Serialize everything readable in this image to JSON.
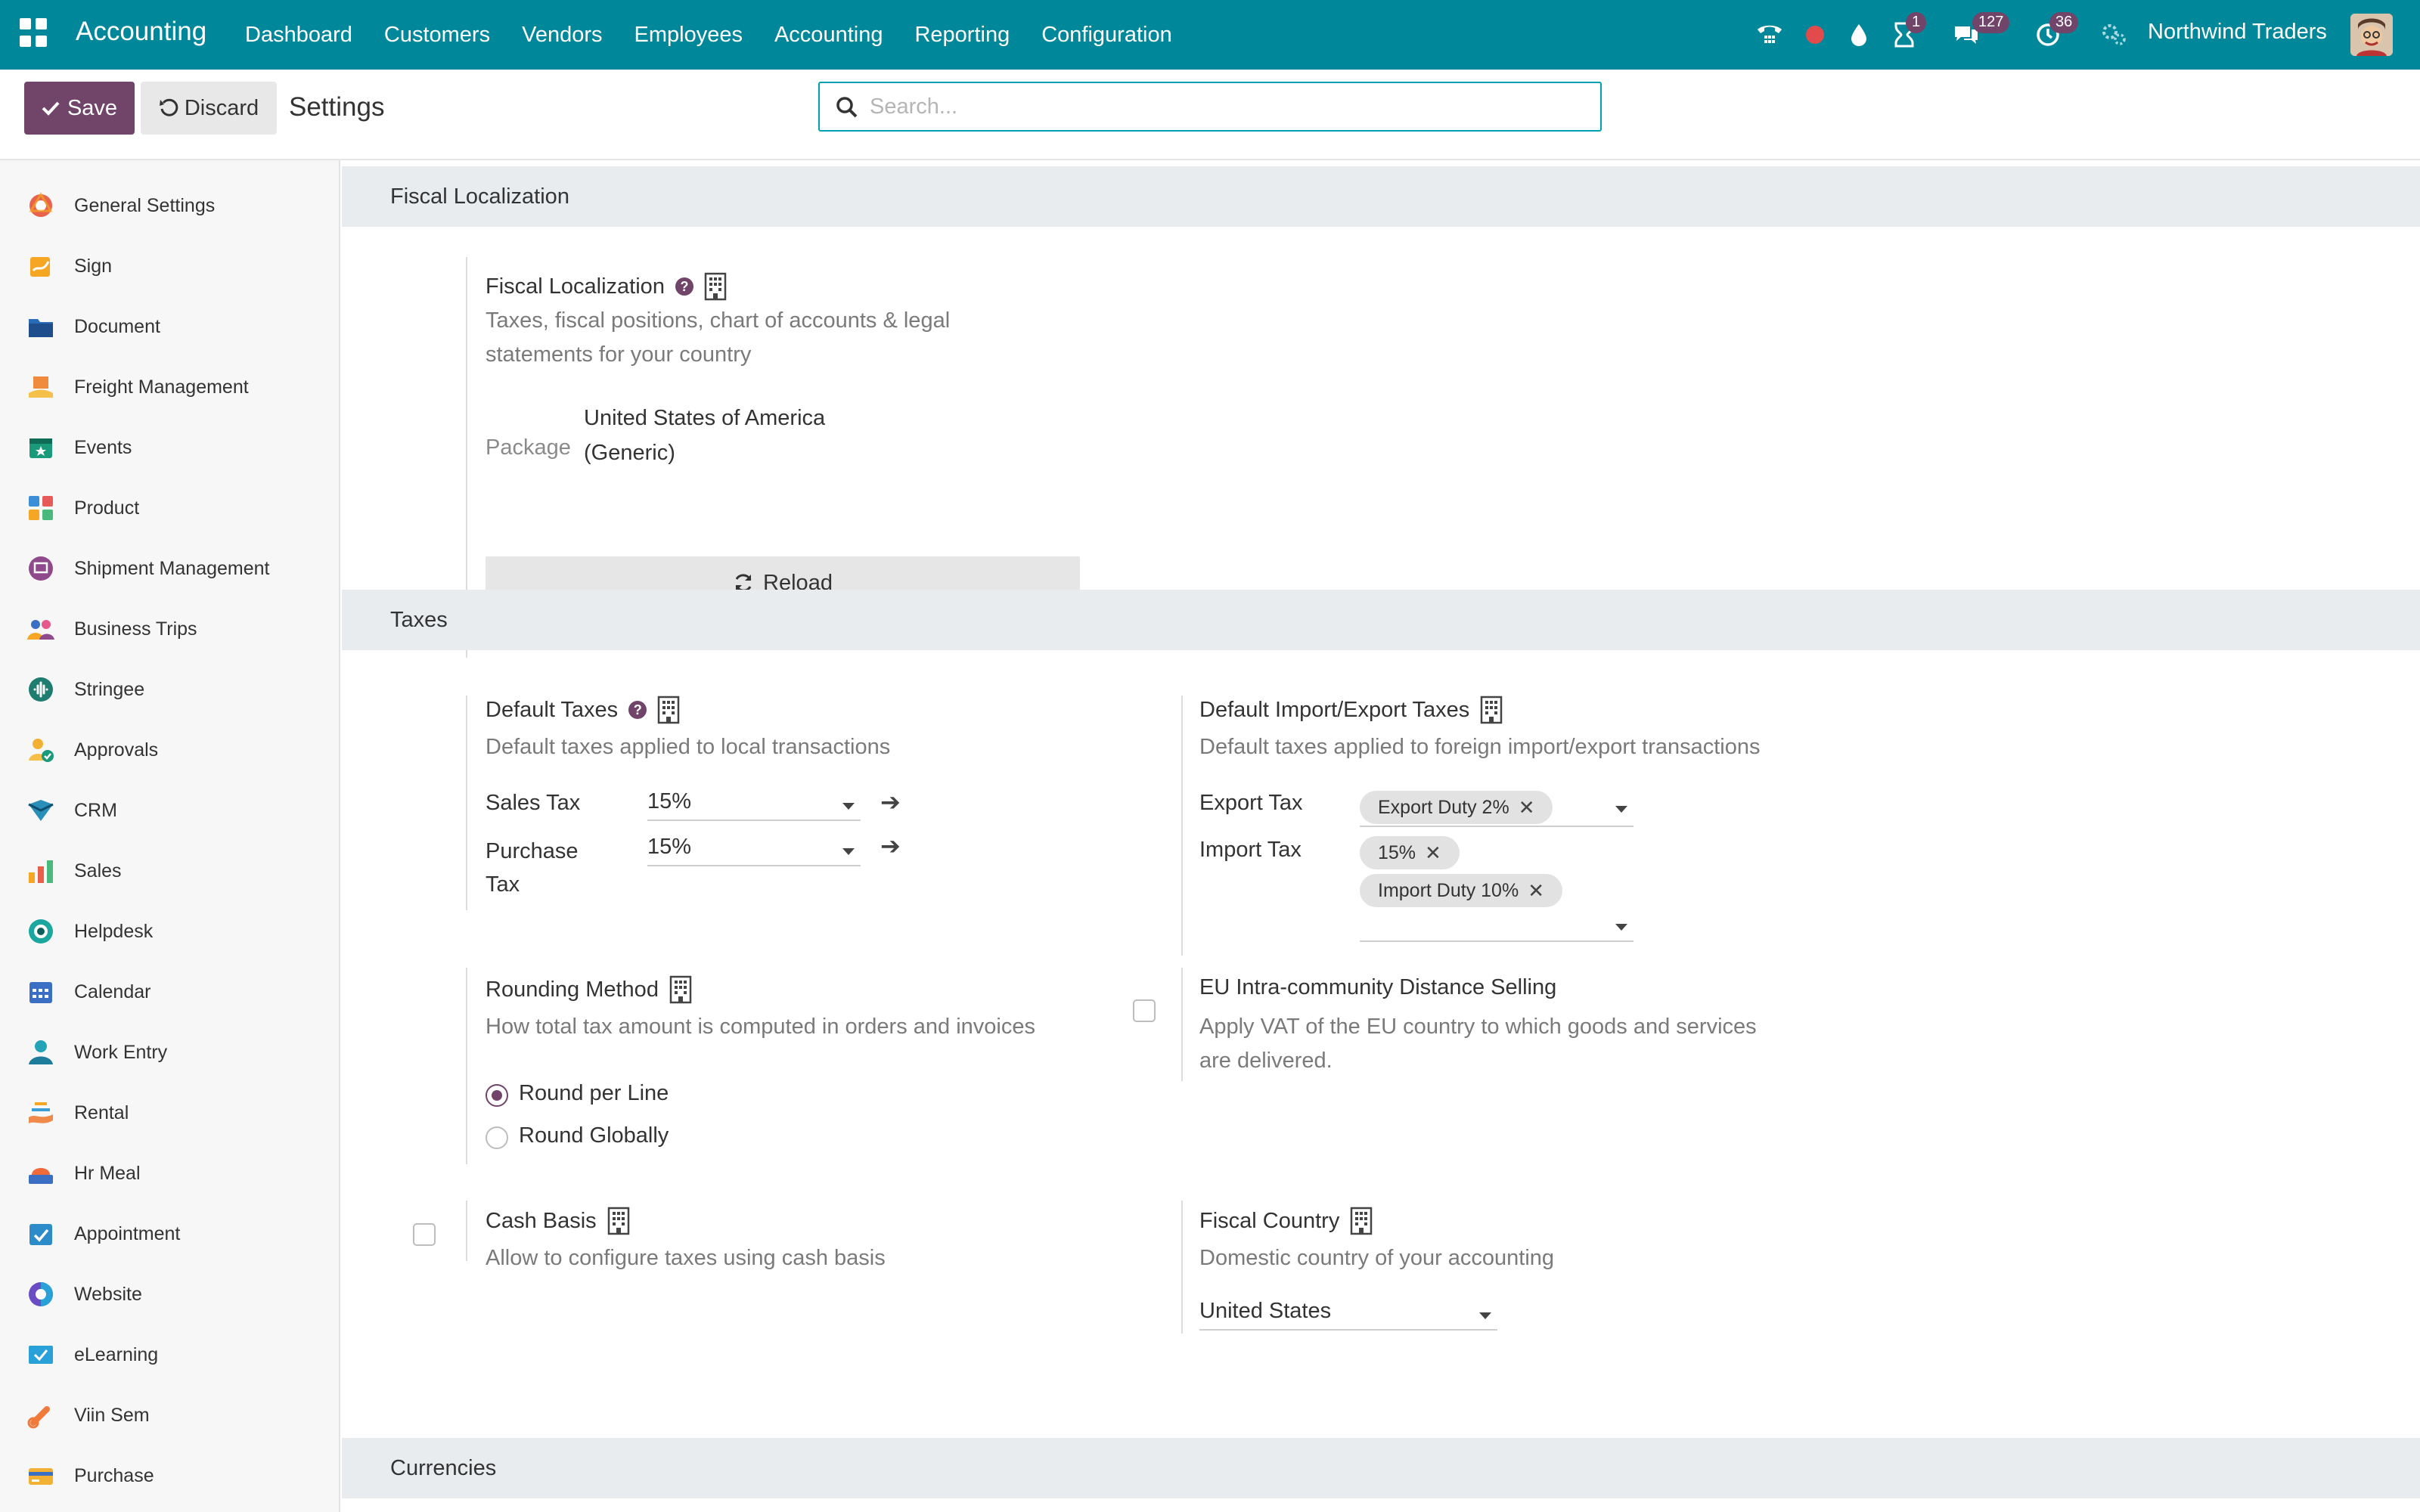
{
  "topbar": {
    "brand": "Accounting",
    "menu": [
      "Dashboard",
      "Customers",
      "Vendors",
      "Employees",
      "Accounting",
      "Reporting",
      "Configuration"
    ],
    "badges": {
      "activity": "1",
      "messages": "127",
      "timer": "36"
    },
    "company": "Northwind Traders"
  },
  "control": {
    "save_label": "Save",
    "discard_label": "Discard",
    "title": "Settings",
    "search_placeholder": "Search..."
  },
  "sidebar": {
    "items": [
      {
        "label": "General Settings",
        "icon": "general-settings-icon",
        "color": "#e8624c"
      },
      {
        "label": "Sign",
        "icon": "sign-icon",
        "color": "#f5a623"
      },
      {
        "label": "Document",
        "icon": "document-icon",
        "color": "#2a6bb8"
      },
      {
        "label": "Freight Management",
        "icon": "freight-icon",
        "color": "#f08a3c"
      },
      {
        "label": "Events",
        "icon": "events-icon",
        "color": "#1a9a7a"
      },
      {
        "label": "Product",
        "icon": "product-icon",
        "color": "#e75a5a"
      },
      {
        "label": "Shipment Management",
        "icon": "shipment-icon",
        "color": "#8e4a8b"
      },
      {
        "label": "Business Trips",
        "icon": "business-trips-icon",
        "color": "#e55a8a"
      },
      {
        "label": "Stringee",
        "icon": "stringee-icon",
        "color": "#1e7d6f"
      },
      {
        "label": "Approvals",
        "icon": "approvals-icon",
        "color": "#f2b134"
      },
      {
        "label": "CRM",
        "icon": "crm-icon",
        "color": "#2a8fb8"
      },
      {
        "label": "Sales",
        "icon": "sales-icon",
        "color": "#e95f4a"
      },
      {
        "label": "Helpdesk",
        "icon": "helpdesk-icon",
        "color": "#1ba7a0"
      },
      {
        "label": "Calendar",
        "icon": "calendar-icon",
        "color": "#3a6fc4"
      },
      {
        "label": "Work Entry",
        "icon": "work-entry-icon",
        "color": "#22a3b8"
      },
      {
        "label": "Rental",
        "icon": "rental-icon",
        "color": "#ef8a4a"
      },
      {
        "label": "Hr Meal",
        "icon": "hr-meal-icon",
        "color": "#f06a3a"
      },
      {
        "label": "Appointment",
        "icon": "appointment-icon",
        "color": "#2c8bc9"
      },
      {
        "label": "Website",
        "icon": "website-icon",
        "color": "#6a4cc4"
      },
      {
        "label": "eLearning",
        "icon": "elearning-icon",
        "color": "#2aa0d8"
      },
      {
        "label": "Viin Sem",
        "icon": "viin-sem-icon",
        "color": "#f07a3a"
      },
      {
        "label": "Purchase",
        "icon": "purchase-icon",
        "color": "#f2b134"
      }
    ]
  },
  "fiscal": {
    "section": "Fiscal Localization",
    "title": "Fiscal Localization",
    "desc_line1": "Taxes, fiscal positions, chart of accounts & legal",
    "desc_line2": "statements for your country",
    "package_label": "Package",
    "package_value_line1": "United States of America",
    "package_value_line2": "(Generic)",
    "reload_label": "Reload"
  },
  "taxes": {
    "section": "Taxes",
    "default_taxes": {
      "title": "Default Taxes",
      "desc": "Default taxes applied to local transactions",
      "sales_label": "Sales Tax",
      "sales_value": "15%",
      "purchase_label_1": "Purchase",
      "purchase_label_2": "Tax",
      "purchase_value": "15%"
    },
    "import_export": {
      "title": "Default Import/Export Taxes",
      "desc": "Default taxes applied to foreign import/export transactions",
      "export_label": "Export Tax",
      "export_tags": [
        "Export Duty 2%"
      ],
      "import_label": "Import Tax",
      "import_tags": [
        "15%",
        "Import Duty 10%"
      ]
    },
    "rounding": {
      "title": "Rounding Method",
      "desc": "How total tax amount is computed in orders and invoices",
      "options": [
        "Round per Line",
        "Round Globally"
      ],
      "selected": "Round per Line"
    },
    "eu": {
      "title": "EU Intra-community Distance Selling",
      "desc_line1": "Apply VAT of the EU country to which goods and services",
      "desc_line2": "are delivered."
    },
    "cash_basis": {
      "title": "Cash Basis",
      "desc": "Allow to configure taxes using cash basis"
    },
    "fiscal_country": {
      "title": "Fiscal Country",
      "desc": "Domestic country of your accounting",
      "value": "United States"
    }
  },
  "currencies": {
    "section": "Currencies"
  },
  "colors": {
    "topbar": "#00879a",
    "primary": "#71446a",
    "section_bg": "#e9ecef"
  }
}
